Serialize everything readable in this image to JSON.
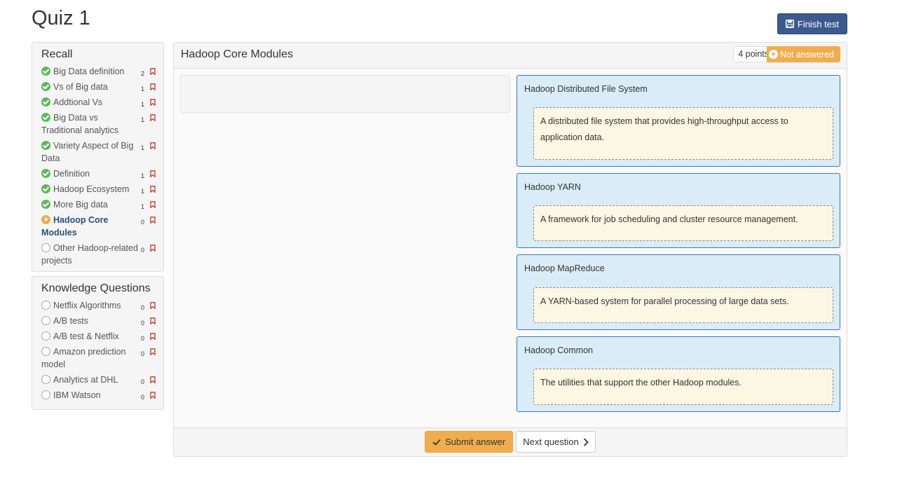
{
  "page": {
    "title": "Quiz 1",
    "finish_label": "Finish test"
  },
  "sidebar": {
    "recall": {
      "heading": "Recall",
      "items": [
        {
          "label": "Big Data definition",
          "count": "2",
          "status": "done"
        },
        {
          "label": "Vs of Big data",
          "count": "1",
          "status": "done"
        },
        {
          "label": "Addtional Vs",
          "count": "1",
          "status": "done"
        },
        {
          "label": "Big Data vs Traditional analytics",
          "count": "1",
          "status": "done"
        },
        {
          "label": "Variety Aspect of Big Data",
          "count": "1",
          "status": "done"
        },
        {
          "label": "Definition",
          "count": "1",
          "status": "done"
        },
        {
          "label": "Hadoop Ecosystem",
          "count": "1",
          "status": "done"
        },
        {
          "label": "More Big data",
          "count": "1",
          "status": "done"
        },
        {
          "label": "Hadoop Core Modules",
          "count": "0",
          "status": "current"
        },
        {
          "label": "Other Hadoop-related projects",
          "count": "0",
          "status": "empty"
        }
      ]
    },
    "knowledge": {
      "heading": "Knowledge Questions",
      "items": [
        {
          "label": "Netflix Algorithms",
          "count": "0",
          "status": "empty"
        },
        {
          "label": "A/B tests",
          "count": "0",
          "status": "empty"
        },
        {
          "label": "A/B test & Netflix",
          "count": "0",
          "status": "empty"
        },
        {
          "label": "Amazon prediction model",
          "count": "0",
          "status": "empty"
        },
        {
          "label": "Analytics at DHL",
          "count": "0",
          "status": "empty"
        },
        {
          "label": "IBM Watson",
          "count": "0",
          "status": "empty"
        }
      ]
    }
  },
  "question": {
    "title": "Hadoop Core Modules",
    "points": "4 points",
    "status": "Not answered",
    "targets": [
      {
        "label": "Hadoop Distributed File System",
        "answer": "A distributed file system that provides high-throughput access to application data."
      },
      {
        "label": "Hadoop YARN",
        "answer": "A framework for job scheduling and cluster resource management."
      },
      {
        "label": "Hadoop MapReduce",
        "answer": "A YARN-based system for parallel processing of large data sets."
      },
      {
        "label": "Hadoop Common",
        "answer": "The utilities that support the other Hadoop modules."
      }
    ]
  },
  "footer": {
    "submit_label": "Submit answer",
    "next_label": "Next question"
  },
  "colors": {
    "accent": "#f0ad4e",
    "primary": "#3b5b8d",
    "success": "#5cb85c",
    "target_bg": "#d9ecf7",
    "answer_bg": "#fcf7e3"
  }
}
